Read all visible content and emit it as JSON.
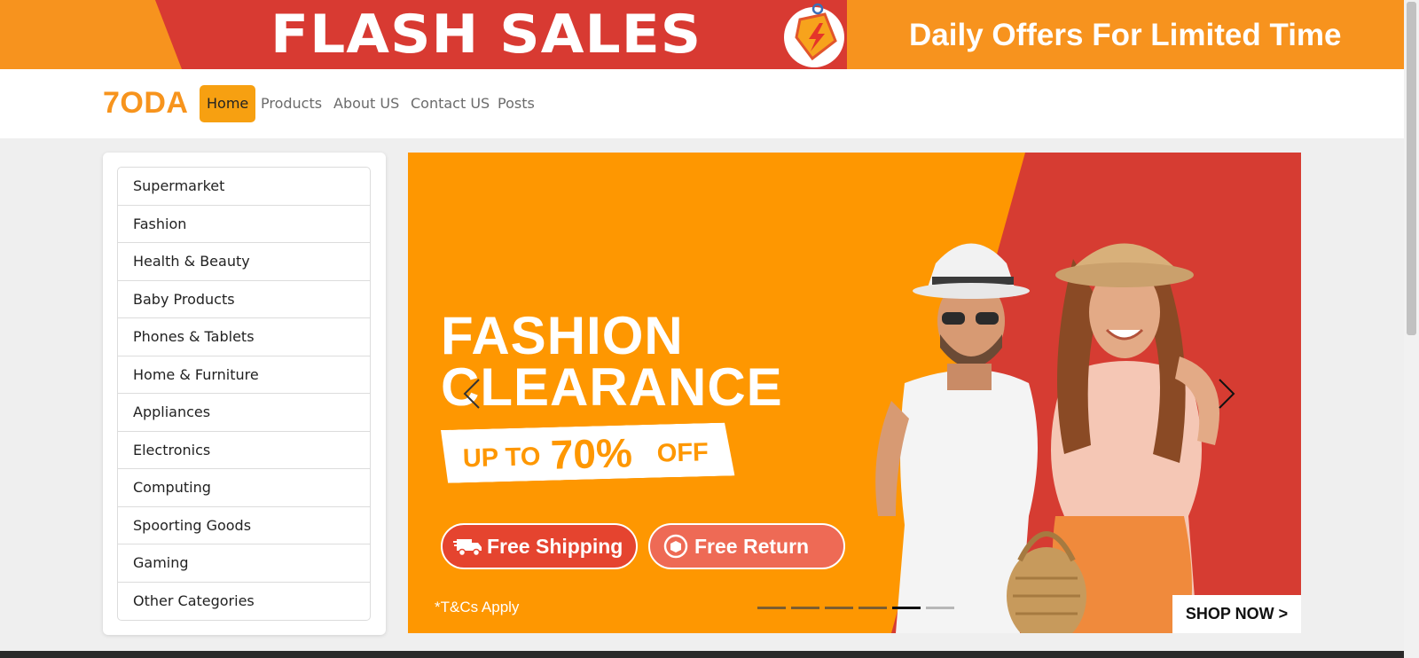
{
  "flash_banner": {
    "title": "FLASH SALES",
    "subtitle": "Daily Offers For Limited Time",
    "icon": "flash-sale-tag-icon"
  },
  "navbar": {
    "logo": "7ODA",
    "links": [
      {
        "label": "Home",
        "active": true
      },
      {
        "label": "Products",
        "active": false
      },
      {
        "label": "About US",
        "active": false
      },
      {
        "label": "Contact US",
        "active": false
      },
      {
        "label": "Posts",
        "active": false
      }
    ]
  },
  "categories": [
    "Supermarket",
    "Fashion",
    "Health & Beauty",
    "Baby Products",
    "Phones & Tablets",
    "Home & Furniture",
    "Appliances",
    "Electronics",
    "Computing",
    "Spoorting Goods",
    "Gaming",
    "Other Categories"
  ],
  "carousel": {
    "headline_line1": "FASHION",
    "headline_line2": "CLEARANCE",
    "offer_prefix": "UP TO",
    "offer_value": "70%",
    "offer_suffix": "OFF",
    "badge_shipping": "Free Shipping",
    "badge_return": "Free Return",
    "terms": "*T&Cs Apply",
    "cta": "SHOP NOW >",
    "slide_count": 6,
    "active_slide": 5,
    "prev_icon": "chevron-left-icon",
    "next_icon": "chevron-right-icon"
  },
  "colors": {
    "brand_orange": "#f7941d",
    "banner_red": "#d83a32",
    "carousel_orange": "#fe9701",
    "active_nav": "#f7a011"
  }
}
